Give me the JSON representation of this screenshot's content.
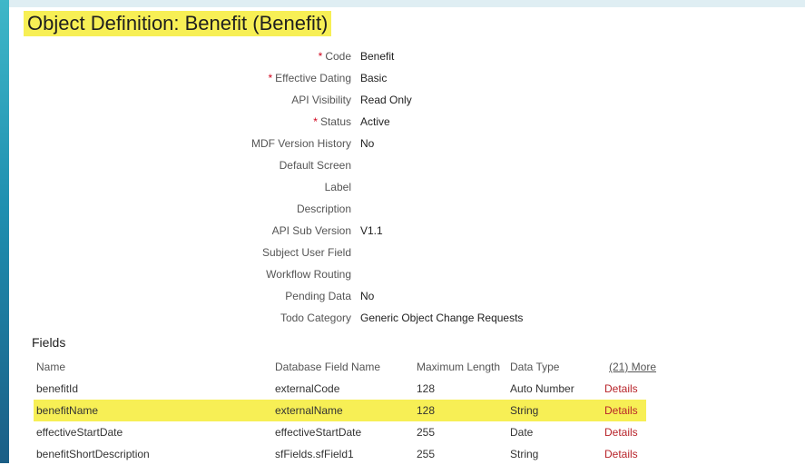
{
  "title": "Object Definition: Benefit (Benefit)",
  "properties": [
    {
      "label": "Code",
      "required": "*",
      "value": "Benefit"
    },
    {
      "label": "Effective Dating",
      "required": "*",
      "value": "Basic"
    },
    {
      "label": "API Visibility",
      "required": "",
      "value": "Read Only"
    },
    {
      "label": "Status",
      "required": "*",
      "value": "Active"
    },
    {
      "label": "MDF Version History",
      "required": "",
      "value": "No"
    },
    {
      "label": "Default Screen",
      "required": "",
      "value": ""
    },
    {
      "label": "Label",
      "required": "",
      "value": ""
    },
    {
      "label": "Description",
      "required": "",
      "value": ""
    },
    {
      "label": "API Sub Version",
      "required": "",
      "value": "V1.1"
    },
    {
      "label": "Subject User Field",
      "required": "",
      "value": ""
    },
    {
      "label": "Workflow Routing",
      "required": "",
      "value": ""
    },
    {
      "label": "Pending Data",
      "required": "",
      "value": "No"
    },
    {
      "label": "Todo Category",
      "required": "",
      "value": "Generic Object Change Requests"
    }
  ],
  "fields": {
    "heading": "Fields",
    "headers": {
      "name": "Name",
      "db_field": "Database Field Name",
      "max_length": "Maximum Length",
      "data_type": "Data Type",
      "more": "(21) More"
    },
    "rows": [
      {
        "name": "benefitId",
        "db_field": "externalCode",
        "max_length": "128",
        "data_type": "Auto Number",
        "action": "Details",
        "highlighted": false
      },
      {
        "name": "benefitName",
        "db_field": "externalName",
        "max_length": "128",
        "data_type": "String",
        "action": "Details",
        "highlighted": true
      },
      {
        "name": "effectiveStartDate",
        "db_field": "effectiveStartDate",
        "max_length": "255",
        "data_type": "Date",
        "action": "Details",
        "highlighted": false
      },
      {
        "name": "benefitShortDescription",
        "db_field": "sfFields.sfField1",
        "max_length": "255",
        "data_type": "String",
        "action": "Details",
        "highlighted": false
      }
    ]
  },
  "colors": {
    "highlight": "#f7ef55",
    "required": "#d0021b",
    "link": "#b8242a"
  }
}
